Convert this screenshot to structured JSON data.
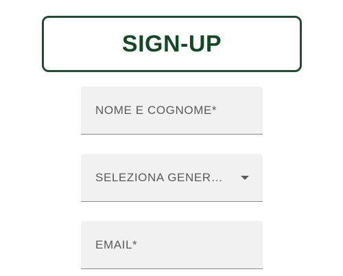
{
  "header": {
    "title": "SIGN-UP"
  },
  "form": {
    "name_placeholder": "NOME E COGNOME*",
    "gender_select_label": "SELEZIONA GENER…",
    "email_placeholder": "EMAIL*"
  },
  "colors": {
    "accent_border": "#1f4d2e",
    "title_text": "#124a24",
    "field_background": "#f1f1f1"
  },
  "icons": {
    "gender_dropdown": "chevron-down-icon"
  }
}
